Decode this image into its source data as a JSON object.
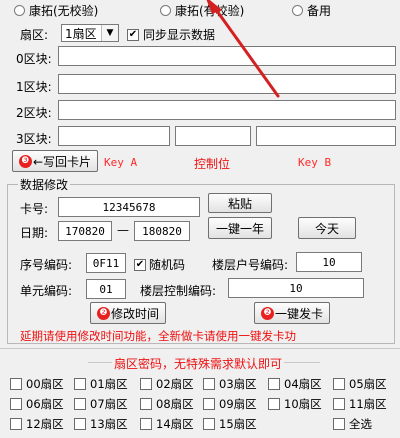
{
  "mode_radios": [
    {
      "label": "康拓(无校验)"
    },
    {
      "label": "康拓(有校验)"
    },
    {
      "label": "备用"
    }
  ],
  "sector": {
    "label": "扇区:",
    "selected": "1扇区",
    "sync_label": "同步显示数据",
    "sync_checked": "✔"
  },
  "blocks": [
    {
      "label": "0区块:"
    },
    {
      "label": "1区块:"
    },
    {
      "label": "2区块:"
    },
    {
      "label": "3区块:"
    }
  ],
  "write_back_button": "←写回卡片",
  "key_labels": {
    "key_a": "Key A",
    "control": "控制位",
    "key_b": "Key B"
  },
  "data_edit": {
    "title": "数据修改",
    "card_no_label": "卡号:",
    "card_no_value": "12345678",
    "paste_button": "粘贴",
    "date_label": "日期:",
    "date_from": "170820",
    "date_sep": "—",
    "date_to": "180820",
    "one_year_button": "一键一年",
    "today_button": "今天",
    "serial_label": "序号编码:",
    "serial_value": "0F11",
    "random_label": "随机码",
    "random_checked": "✔",
    "floor_room_label": "楼层户号编码:",
    "floor_room_value": "10",
    "unit_label": "单元编码:",
    "unit_value": "01",
    "floor_ctrl_label": "楼层控制编码:",
    "floor_ctrl_value": "10",
    "modify_time_button": "修改时间",
    "issue_card_button": "一键发卡",
    "badge_1": "❷",
    "badge_2": "❷",
    "badge_w": "❸",
    "hint": "延期请使用修改时间功能，全新做卡请使用一键发卡功"
  },
  "sector_pwd": {
    "title": "扇区密码，无特殊需求默认即可",
    "items": [
      "00扇区",
      "01扇区",
      "02扇区",
      "03扇区",
      "04扇区",
      "05扇区",
      "06扇区",
      "07扇区",
      "08扇区",
      "09扇区",
      "10扇区",
      "11扇区",
      "12扇区",
      "13扇区",
      "14扇区",
      "15扇区"
    ],
    "select_all": "全选"
  },
  "colors": {
    "annotation_red": "#e11111",
    "arrow": "#d42020"
  }
}
